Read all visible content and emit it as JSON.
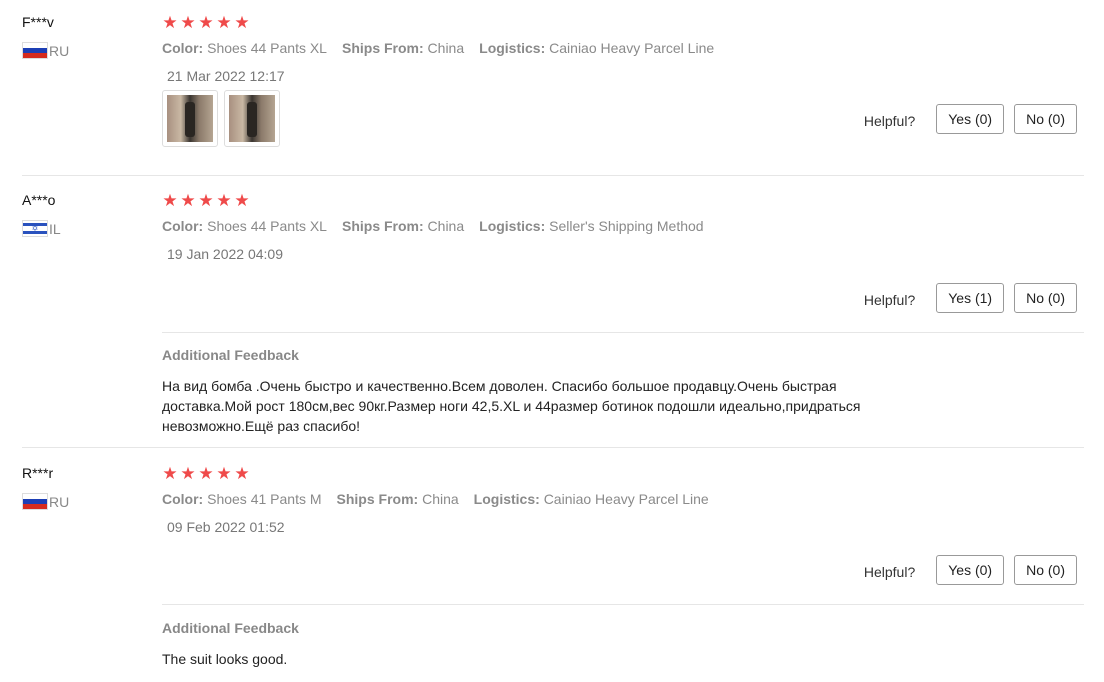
{
  "labels": {
    "color": "Color:",
    "ships_from": "Ships From:",
    "logistics": "Logistics:",
    "helpful": "Helpful?",
    "additional_feedback": "Additional Feedback"
  },
  "colors": {
    "star": "#ef4a4a",
    "muted": "#8a8a8a"
  },
  "reviews": [
    {
      "user": "F***v",
      "country": "RU",
      "flag_icon": "russia-flag-icon",
      "rating": 5,
      "color": "Shoes 44 Pants XL",
      "ships_from": "China",
      "logistics": "Cainiao Heavy Parcel Line",
      "date": "21 Mar 2022 12:17",
      "photos": 2,
      "yes": "Yes (0)",
      "no": "No (0)"
    },
    {
      "user": "A***o",
      "country": "IL",
      "flag_icon": "israel-flag-icon",
      "rating": 5,
      "color": "Shoes 44 Pants XL",
      "ships_from": "China",
      "logistics": "Seller's Shipping Method",
      "date": "19 Jan 2022 04:09",
      "yes": "Yes (1)",
      "no": "No (0)",
      "additional_feedback": "На вид бомба .Очень быстро и качественно.Всем доволен. Спасибо большое продавцу.Очень быстрая доставка.Мой рост 180см,вес 90кг.Размер ноги 42,5.XL и 44размер ботинок подошли идеально,придраться невозможно.Ещё раз спасибо!"
    },
    {
      "user": "R***r",
      "country": "RU",
      "flag_icon": "russia-flag-icon",
      "rating": 5,
      "color": "Shoes 41 Pants M",
      "ships_from": "China",
      "logistics": "Cainiao Heavy Parcel Line",
      "date": "09 Feb 2022 01:52",
      "yes": "Yes (0)",
      "no": "No (0)",
      "additional_feedback": "The suit looks good."
    }
  ]
}
